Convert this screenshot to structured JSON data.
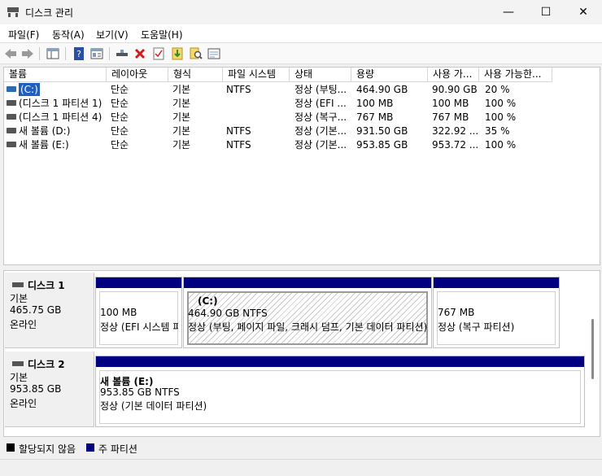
{
  "window": {
    "title": "디스크 관리",
    "minimize_glyph": "—",
    "maximize_glyph": "☐",
    "close_glyph": "✕"
  },
  "menu": {
    "items": [
      "파일(F)",
      "동작(A)",
      "보기(V)",
      "도움말(H)"
    ]
  },
  "toolbar": {
    "icons": [
      "back-arrow-icon",
      "forward-arrow-icon",
      "console-tree-icon",
      "help-icon",
      "properties-view-icon",
      "connect-drive-icon",
      "delete-icon",
      "checklist-icon",
      "import-icon",
      "search-disk-icon",
      "settings-panel-icon"
    ]
  },
  "volume_list": {
    "columns": [
      "볼륨",
      "레이아웃",
      "형식",
      "파일 시스템",
      "상태",
      "용량",
      "사용 가...",
      "사용 가능한..."
    ],
    "rows": [
      {
        "volume": "(C:)",
        "layout": "단순",
        "type": "기본",
        "fs": "NTFS",
        "status": "정상 (부팅...",
        "capacity": "464.90 GB",
        "free": "90.90 GB",
        "pct": "20 %",
        "selected": true
      },
      {
        "volume": "(디스크 1 파티션 1)",
        "layout": "단순",
        "type": "기본",
        "fs": "",
        "status": "정상 (EFI ...",
        "capacity": "100 MB",
        "free": "100 MB",
        "pct": "100 %"
      },
      {
        "volume": "(디스크 1 파티션 4)",
        "layout": "단순",
        "type": "기본",
        "fs": "",
        "status": "정상 (복구...",
        "capacity": "767 MB",
        "free": "767 MB",
        "pct": "100 %"
      },
      {
        "volume": "새 볼륨 (D:)",
        "layout": "단순",
        "type": "기본",
        "fs": "NTFS",
        "status": "정상 (기본...",
        "capacity": "931.50 GB",
        "free": "322.92 ...",
        "pct": "35 %"
      },
      {
        "volume": "새 볼륨 (E:)",
        "layout": "단순",
        "type": "기본",
        "fs": "NTFS",
        "status": "정상 (기본...",
        "capacity": "953.85 GB",
        "free": "953.72 ...",
        "pct": "100 %"
      }
    ]
  },
  "disks": [
    {
      "name": "디스크 1",
      "kind": "기본",
      "size": "465.75 GB",
      "state": "온라인",
      "partitions": [
        {
          "title": "",
          "size": "100 MB",
          "status": "정상 (EFI 시스템 파티션)"
        },
        {
          "title": "(C:)",
          "size": "464.90 GB NTFS",
          "status": "정상 (부팅, 페이지 파일, 크래시 덤프, 기본 데이터 파티션)"
        },
        {
          "title": "",
          "size": "767 MB",
          "status": "정상 (복구 파티션)"
        }
      ]
    },
    {
      "name": "디스크 2",
      "kind": "기본",
      "size": "953.85 GB",
      "state": "온라인",
      "partitions": [
        {
          "title": "새 볼륨 (E:)",
          "size": "953.85 GB NTFS",
          "status": "정상 (기본 데이터 파티션)"
        }
      ]
    }
  ],
  "legend": [
    {
      "label": "할당되지 않음",
      "color": "#000000"
    },
    {
      "label": "주 파티션",
      "color": "#000080"
    }
  ]
}
